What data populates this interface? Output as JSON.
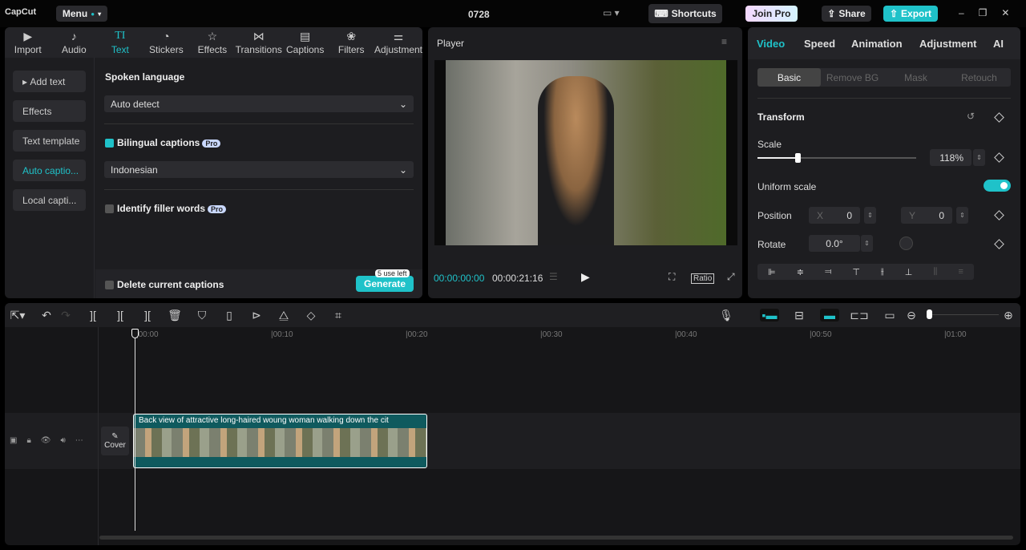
{
  "app": {
    "logo": "CapCut",
    "menu": "Menu",
    "title": "0728",
    "shortcuts": "Shortcuts",
    "join_pro": "Join Pro",
    "share": "Share",
    "export": "Export"
  },
  "media_tabs": [
    {
      "label": "Import",
      "icon": "import-icon"
    },
    {
      "label": "Audio",
      "icon": "audio-icon"
    },
    {
      "label": "Text",
      "icon": "text-icon"
    },
    {
      "label": "Stickers",
      "icon": "stickers-icon"
    },
    {
      "label": "Effects",
      "icon": "effects-icon"
    },
    {
      "label": "Transitions",
      "icon": "transitions-icon"
    },
    {
      "label": "Captions",
      "icon": "captions-icon"
    },
    {
      "label": "Filters",
      "icon": "filters-icon"
    },
    {
      "label": "Adjustment",
      "icon": "adjustment-icon"
    }
  ],
  "text_nav": [
    "Add text",
    "Effects",
    "Text template",
    "Auto captio...",
    "Local capti..."
  ],
  "captions": {
    "spoken_language_label": "Spoken language",
    "spoken_language": "Auto detect",
    "bilingual_label": "Bilingual captions",
    "pro": "Pro",
    "bilingual_language": "Indonesian",
    "filler_label": "Identify filler words",
    "delete_label": "Delete current captions",
    "uses_left": "5 use left",
    "generate": "Generate"
  },
  "player": {
    "title": "Player",
    "current_time": "00:00:00:00",
    "total_time": "00:00:21:16",
    "ratio": "Ratio"
  },
  "inspector": {
    "tabs": [
      "Video",
      "Speed",
      "Animation",
      "Adjustment",
      "AI"
    ],
    "subtabs": [
      "Basic",
      "Remove BG",
      "Mask",
      "Retouch"
    ],
    "transform": "Transform",
    "scale_label": "Scale",
    "scale_value": "118%",
    "scale_fraction": 0.25,
    "uniform_scale": "Uniform scale",
    "uniform_on": true,
    "position_label": "Position",
    "x_label": "X",
    "x": "0",
    "y_label": "Y",
    "y": "0",
    "rotate_label": "Rotate",
    "rotate": "0.0°"
  },
  "timeline": {
    "ticks": [
      "00:00",
      "00:10",
      "00:20",
      "00:30",
      "00:40",
      "00:50",
      "01:00"
    ],
    "clip_title": "Back view of attractive long-haired woung woman walking down the cit",
    "cover": "Cover"
  },
  "colors": {
    "accent": "#1fc2c9",
    "export": "#1fc2c9"
  }
}
